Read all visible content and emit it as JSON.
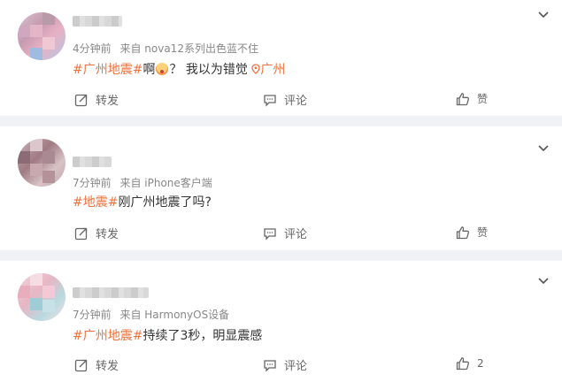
{
  "posts": [
    {
      "meta_time": "4分钟前",
      "meta_source": "来自 nova12系列出色蓝不住",
      "topic": "#广州地震#",
      "text_after_topic": "啊",
      "text_after_emoji": "？ 我以为错觉",
      "location_icon": "location-pin-icon",
      "location": "广州",
      "actions": {
        "repost": "转发",
        "comment": "评论",
        "like": "赞"
      }
    },
    {
      "meta_time": "7分钟前",
      "meta_source": "来自 iPhone客户端",
      "topic": "#地震#",
      "text_after_topic": "刚广州地震了吗?",
      "actions": {
        "repost": "转发",
        "comment": "评论",
        "like": "赞"
      }
    },
    {
      "meta_time": "7分钟前",
      "meta_source": "来自 HarmonyOS设备",
      "topic": "#广州地震#",
      "text_after_topic": "持续了3秒，明显震感",
      "actions": {
        "repost": "转发",
        "comment": "评论",
        "like": "2"
      }
    }
  ],
  "colors": {
    "accent": "#eb7340",
    "background": "#f1f2f5"
  }
}
